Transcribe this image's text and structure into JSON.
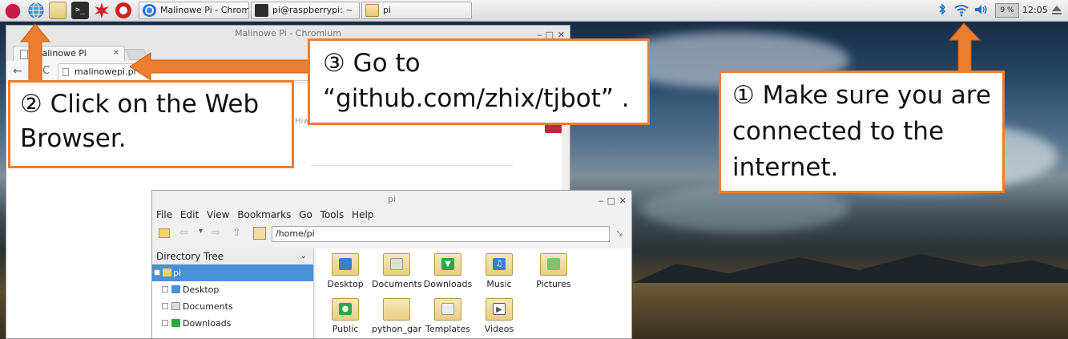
{
  "taskbar": {
    "tasks": [
      {
        "label": "Malinowe Pi - Chrom..."
      },
      {
        "label": "pi@raspberrypi: ~"
      },
      {
        "label": "pi"
      }
    ],
    "cpu": "9 %",
    "clock": "12:05"
  },
  "chromium": {
    "window_title": "Malinowe Pi - Chromium",
    "tab_title": "Malinowe Pi",
    "url": "malinowepi.pl",
    "partial_text": "Hiw"
  },
  "file_manager": {
    "window_title": "pi",
    "menu": [
      "File",
      "Edit",
      "View",
      "Bookmarks",
      "Go",
      "Tools",
      "Help"
    ],
    "path": "/home/pi",
    "sidebar_header": "Directory Tree",
    "tree": [
      {
        "label": "pi",
        "selected": true
      },
      {
        "label": "Desktop"
      },
      {
        "label": "Documents"
      },
      {
        "label": "Downloads"
      }
    ],
    "items": [
      {
        "label": "Desktop"
      },
      {
        "label": "Documents"
      },
      {
        "label": "Downloads"
      },
      {
        "label": "Music"
      },
      {
        "label": "Pictures"
      },
      {
        "label": "Public"
      },
      {
        "label": "python_gam"
      },
      {
        "label": "Templates"
      },
      {
        "label": "Videos"
      }
    ]
  },
  "callouts": {
    "step1": "① Make sure you are connected to the internet.",
    "step2": "② Click on the Web Browser.",
    "step3": "③ Go to “github.com/zhix/tjbot” ."
  },
  "colors": {
    "callout_border": "#ed7d31",
    "selection": "#4a90d9"
  }
}
